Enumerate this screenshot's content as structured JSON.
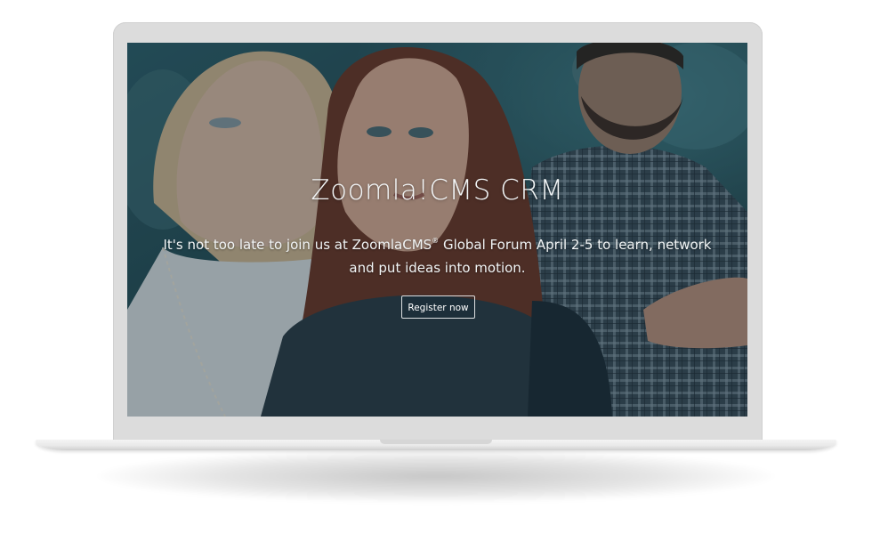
{
  "hero": {
    "title": "Zoomla!CMS CRM",
    "subtitle_part1": "It's not too late to join us at ZoomlaCMS",
    "subtitle_mark": "®",
    "subtitle_part2": " Global Forum April 2-5 to learn, network and put ideas into motion.",
    "cta_label": "Register now"
  },
  "colors": {
    "bezel": "#dcdcdc",
    "overlay": "#0e222c",
    "text": "#ffffff"
  }
}
